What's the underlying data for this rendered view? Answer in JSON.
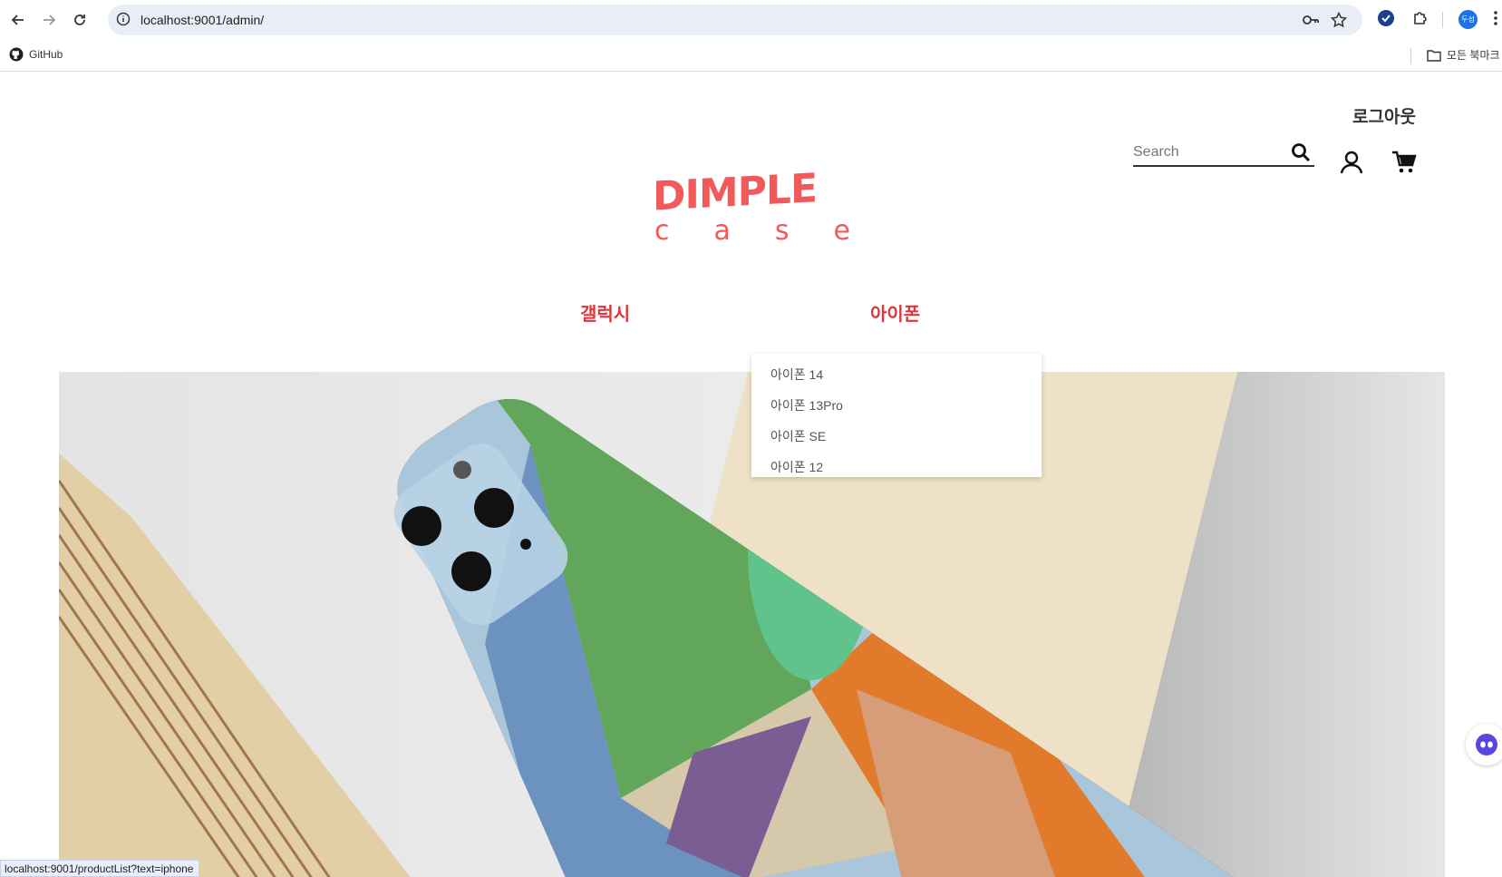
{
  "browser": {
    "url": "localhost:9001/admin/",
    "bookmarks": {
      "github": "GitHub",
      "all_bookmarks": "모든 북마크"
    },
    "profile_initials": "두성",
    "status_url": "localhost:9001/productList?text=iphone"
  },
  "header": {
    "logout": "로그아웃",
    "search_placeholder": "Search",
    "icons": [
      "search-icon",
      "user-icon",
      "cart-icon"
    ]
  },
  "logo": {
    "top": "DIMPLE",
    "bottom": [
      "c",
      "a",
      "s",
      "e"
    ],
    "color": "#f05a5a"
  },
  "nav": {
    "items": [
      {
        "label": "갤럭시"
      },
      {
        "label": "아이폰"
      }
    ],
    "color": "#d9383c"
  },
  "dropdown": {
    "items": [
      "아이폰 14",
      "아이폰 13Pro",
      "아이폰 SE",
      "아이폰 12"
    ]
  }
}
